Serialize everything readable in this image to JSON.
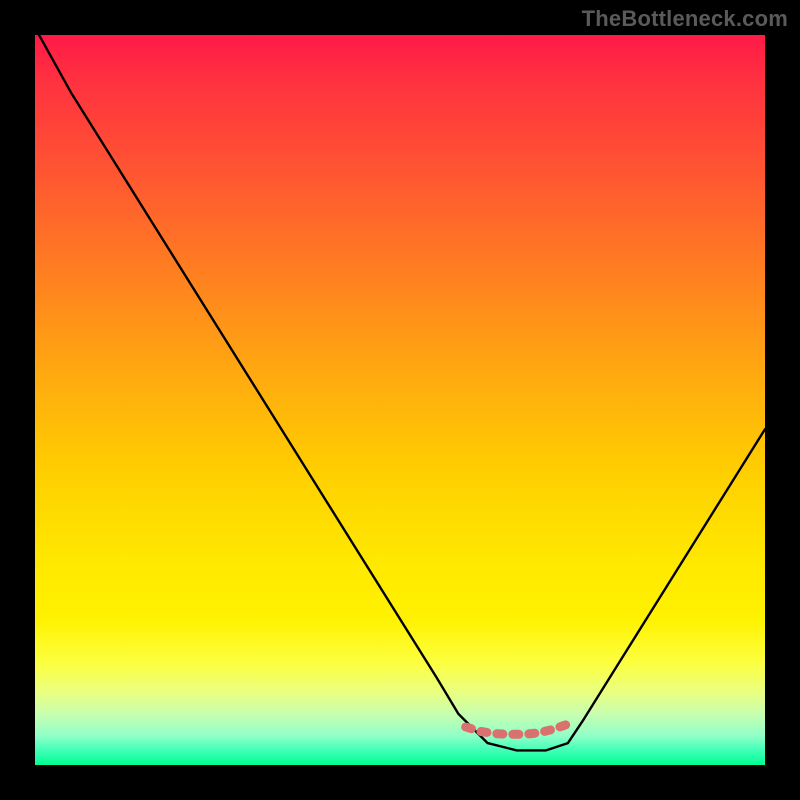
{
  "watermark": "TheBottleneck.com",
  "chart_data": {
    "type": "line",
    "title": "",
    "xlabel": "",
    "ylabel": "",
    "xlim": [
      0,
      100
    ],
    "ylim": [
      0,
      100
    ],
    "grid": false,
    "series": [
      {
        "name": "bottleneck-curve",
        "x": [
          0,
          5,
          10,
          15,
          20,
          25,
          30,
          35,
          40,
          45,
          50,
          55,
          58,
          62,
          66,
          70,
          73,
          75,
          80,
          85,
          90,
          95,
          100
        ],
        "values": [
          101,
          92,
          84,
          76,
          68,
          60,
          52,
          44,
          36,
          28,
          20,
          12,
          7,
          3,
          2,
          2,
          3,
          6,
          14,
          22,
          30,
          38,
          46
        ]
      },
      {
        "name": "sweet-spot-band",
        "x": [
          59,
          61,
          63,
          65,
          67,
          69,
          71,
          73
        ],
        "values": [
          5.2,
          4.6,
          4.3,
          4.2,
          4.2,
          4.4,
          4.9,
          5.6
        ]
      }
    ],
    "annotations": {
      "sweet_spot_range_pct": [
        59,
        73
      ]
    }
  },
  "colors": {
    "curve": "#000000",
    "band": "#d9716f",
    "frame": "#000000"
  }
}
